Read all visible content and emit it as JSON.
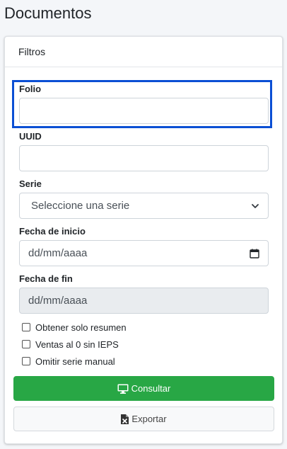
{
  "page": {
    "title": "Documentos"
  },
  "filters": {
    "header": "Filtros",
    "folio": {
      "label": "Folio",
      "value": ""
    },
    "uuid": {
      "label": "UUID",
      "value": ""
    },
    "serie": {
      "label": "Serie",
      "selected": "Seleccione una serie"
    },
    "fecha_inicio": {
      "label": "Fecha de inicio",
      "placeholder": "dd/mm/aaaa"
    },
    "fecha_fin": {
      "label": "Fecha de fin",
      "placeholder": "dd/mm/aaaa"
    },
    "checkboxes": [
      {
        "label": "Obtener solo resumen",
        "checked": false
      },
      {
        "label": "Ventas al 0 sin IEPS",
        "checked": false
      },
      {
        "label": "Omitir serie manual",
        "checked": false
      }
    ],
    "consultar_label": "Consultar",
    "exportar_label": "Exportar"
  },
  "colors": {
    "success": "#28a745",
    "focus": "#0b4fd4",
    "disabled_bg": "#e9ecef"
  }
}
